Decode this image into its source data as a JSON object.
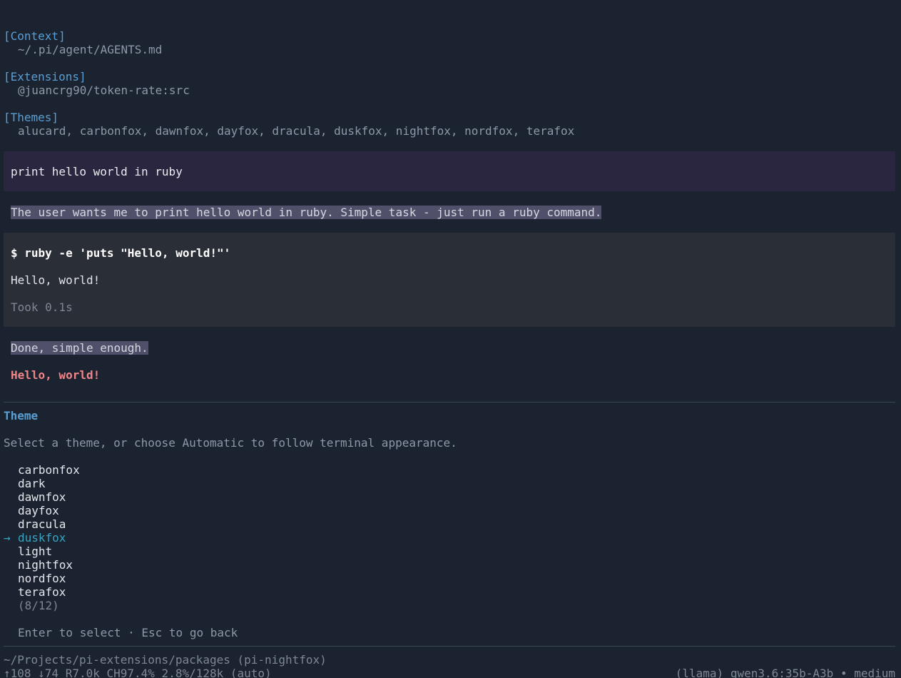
{
  "context": {
    "header": "[Context]",
    "items": [
      "~/.pi/agent/AGENTS.md"
    ]
  },
  "extensions": {
    "header": "[Extensions]",
    "items": [
      "@juancrg90/token-rate:src"
    ]
  },
  "themes_section": {
    "header": "[Themes]",
    "items": [
      "alucard, carbonfox, dawnfox, dayfox, dracula, duskfox, nightfox, nordfox, terafox"
    ]
  },
  "conversation": {
    "user_message": "print hello world in ruby",
    "thinking_1": "The user wants me to print hello world in ruby. Simple task - just run a ruby command.",
    "tool_command": "$ ruby -e 'puts \"Hello, world!\"'",
    "tool_output": "Hello, world!",
    "tool_duration": "Took 0.1s",
    "thinking_2": "Done, simple enough.",
    "assistant_reply": "Hello, world!"
  },
  "theme_picker": {
    "title": "Theme",
    "subtitle": "Select a theme, or choose Automatic to follow terminal appearance.",
    "options": [
      "carbonfox",
      "dark",
      "dawnfox",
      "dayfox",
      "dracula",
      "duskfox",
      "light",
      "nightfox",
      "nordfox",
      "terafox"
    ],
    "selected_index": 5,
    "selection_marker": "→",
    "count": "(8/12)",
    "hint": "Enter to select · Esc to go back"
  },
  "status": {
    "cwd": "~/Projects/pi-extensions/packages (pi-nightfox)",
    "stats": "↑108 ↓74 R7.0k CH97.4% 2.8%/128k (auto)",
    "model": "(llama) qwen3.6:35b-A3b • medium"
  },
  "colors": {
    "background": "#1b2331",
    "accent": "#5a9fd3",
    "selected": "#38a3c1",
    "answer": "#f08688"
  }
}
